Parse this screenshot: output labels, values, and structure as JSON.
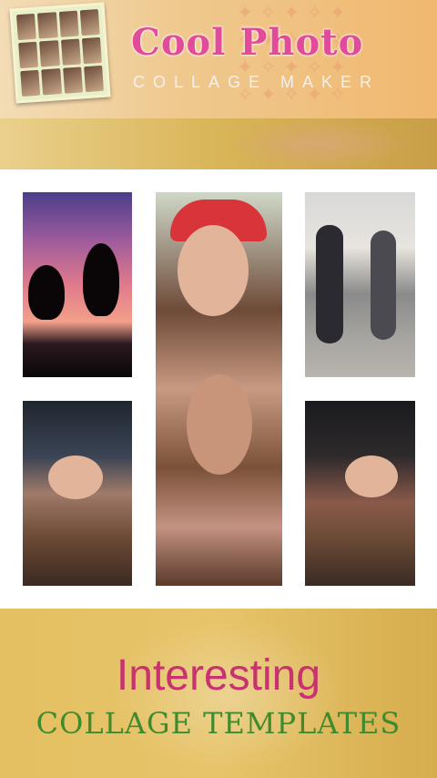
{
  "header": {
    "title": "Cool Photo",
    "subtitle": "COLLAGE MAKER",
    "colors": {
      "title": "#e24b9a",
      "subtitle": "#f4f0f0"
    }
  },
  "collage": {
    "photos": [
      {
        "name": "sunset-silhouette-photo"
      },
      {
        "name": "girl-red-cap-photo"
      },
      {
        "name": "friends-walking-photo"
      },
      {
        "name": "lying-girl-photo"
      },
      {
        "name": "lying-girl-photo-2"
      }
    ]
  },
  "promo": {
    "headline": "Interesting",
    "subheadline": "COLLAGE TEMPLATES",
    "colors": {
      "headline": "#c8336f",
      "subheadline": "#3f8a2c"
    }
  }
}
